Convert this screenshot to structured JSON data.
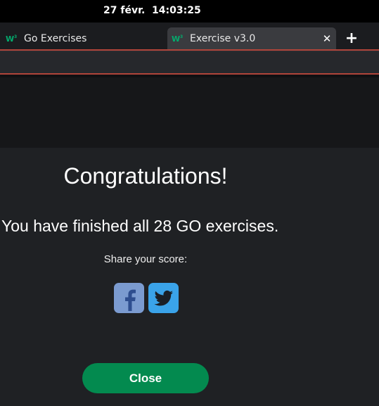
{
  "system_bar": {
    "clock": "27 févr.  14:03:25"
  },
  "tabs": [
    {
      "title": "Go Exercises",
      "favicon": "w3schools-icon",
      "active": false
    },
    {
      "title": "Exercise v3.0",
      "favicon": "w3schools-icon",
      "active": true,
      "close_glyph": "✕"
    }
  ],
  "new_tab_glyph": "+",
  "dialog": {
    "title": "Congratulations!",
    "message": "You have finished all 28 GO exercises.",
    "share_label": "Share your score:",
    "share_buttons": [
      {
        "icon": "facebook-icon",
        "color": "#7b9bd0"
      },
      {
        "icon": "twitter-icon",
        "color": "#3aa3e9"
      }
    ],
    "close_label": "Close",
    "close_color": "#038a4f"
  },
  "colors": {
    "accent_border": "#b0443a",
    "favicon_green": "#04aa6d"
  }
}
